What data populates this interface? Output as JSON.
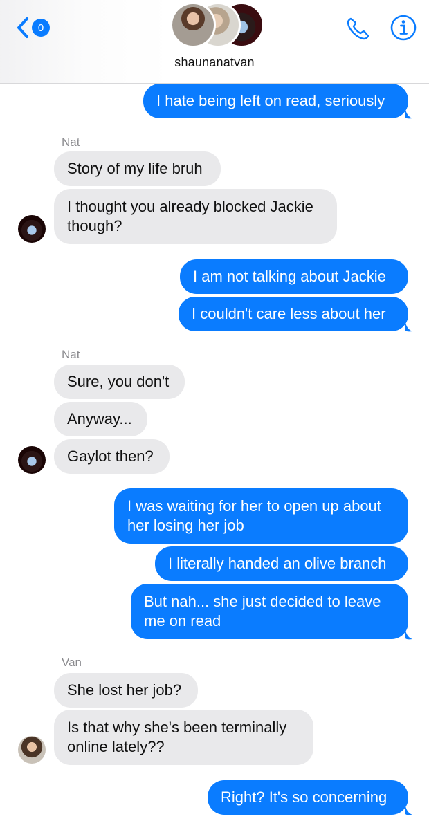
{
  "header": {
    "back_badge": "0",
    "title": "shaunanatvan",
    "colors": {
      "accent": "#0a7cff"
    },
    "icons": [
      "chevron-left-icon",
      "phone-icon",
      "info-icon"
    ]
  },
  "messages": [
    {
      "dir": "out",
      "text": "I hate being left on read, seriously"
    },
    {
      "sender": "Nat"
    },
    {
      "dir": "in",
      "text": "Story of my life bruh"
    },
    {
      "dir": "in",
      "text": "I thought you already blocked Jackie though?"
    },
    {
      "dir": "out",
      "text": "I am not talking about Jackie"
    },
    {
      "dir": "out",
      "text": "I couldn't care less about her"
    },
    {
      "sender": "Nat"
    },
    {
      "dir": "in",
      "text": "Sure, you don't"
    },
    {
      "dir": "in",
      "text": "Anyway..."
    },
    {
      "dir": "in",
      "text": "Gaylot then?"
    },
    {
      "dir": "out",
      "text": "I was waiting for her to open up about her losing her job"
    },
    {
      "dir": "out",
      "text": "I literally handed an olive branch"
    },
    {
      "dir": "out",
      "text": "But nah... she just decided to leave me on read"
    },
    {
      "sender": "Van"
    },
    {
      "dir": "in",
      "text": "She lost her job?"
    },
    {
      "dir": "in",
      "text": "Is that why she's been terminally online lately??"
    },
    {
      "dir": "out",
      "text": "Right? It's so concerning"
    }
  ],
  "bubble_lines": {
    "m3_l1": "I thought you already blocked Jackie",
    "m3_l2": "though?",
    "m10_l1": "I was waiting for her to open up about",
    "m10_l2": "her losing her job",
    "m12_l1": "But nah... she just decided to leave",
    "m12_l2": "me on read",
    "m15_l1": "Is that why she's been terminally",
    "m15_l2": "online lately??"
  }
}
